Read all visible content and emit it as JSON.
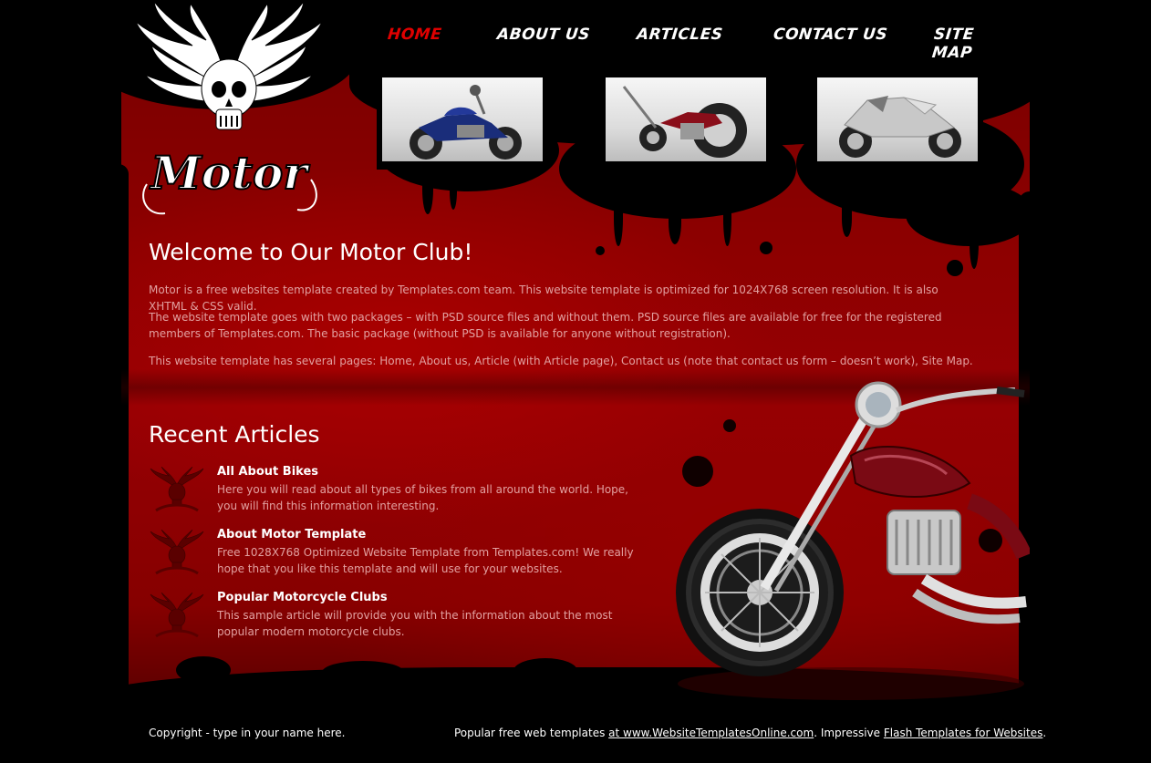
{
  "nav": {
    "items": [
      {
        "label": "Home",
        "active": true
      },
      {
        "label": "About Us",
        "active": false
      },
      {
        "label": "Articles",
        "active": false
      },
      {
        "label": "Contact Us",
        "active": false
      },
      {
        "label": "Site Map",
        "active": false
      }
    ]
  },
  "logo": {
    "text": "Motor",
    "icon": "winged-skull-icon"
  },
  "gallery": [
    {
      "icon": "cruiser-motorcycle-icon",
      "color": "#1a2d7a"
    },
    {
      "icon": "chopper-motorcycle-icon",
      "color": "#8a0e1a"
    },
    {
      "icon": "sport-motorcycle-icon",
      "color": "#c0c0c0"
    }
  ],
  "welcome": {
    "title": "Welcome to Our Motor Club!",
    "paragraphs": [
      "Motor is a free websites template created by Templates.com team. This website template is optimized for 1024X768 screen resolution. It is also XHTML & CSS valid.",
      "The website template goes with two packages – with PSD source files and without them. PSD source files are available for free for the registered members of Templates.com. The basic package (without PSD is available for anyone without registration).",
      "This website template has several pages: Home, About us, Article (with Article page), Contact us (note that contact us form – doesn’t work), Site Map."
    ]
  },
  "recent": {
    "title": "Recent Articles",
    "articles": [
      {
        "title": "All About Bikes",
        "text": "Here you will read about all types of bikes from all around the world. Hope, you will find this information interesting."
      },
      {
        "title": "About Motor Template",
        "text": "Free 1028X768 Optimized Website Template from Templates.com! We really hope that you like this template and will use for your websites."
      },
      {
        "title": "Popular Motorcycle Clubs",
        "text": "This sample article will provide you with the information about the most popular modern motorcycle clubs."
      }
    ]
  },
  "footer": {
    "copyright": "Copyright - type in your name here.",
    "prefix": "Popular free web templates ",
    "link1": "at www.WebsiteTemplatesOnline.com",
    "middle": ". Impressive ",
    "link2": "Flash Templates for Websites",
    "suffix": "."
  },
  "colors": {
    "background": "#000000",
    "red": "#8d0000",
    "nav_active": "#e00000",
    "body_text": "#e2a0a0"
  }
}
